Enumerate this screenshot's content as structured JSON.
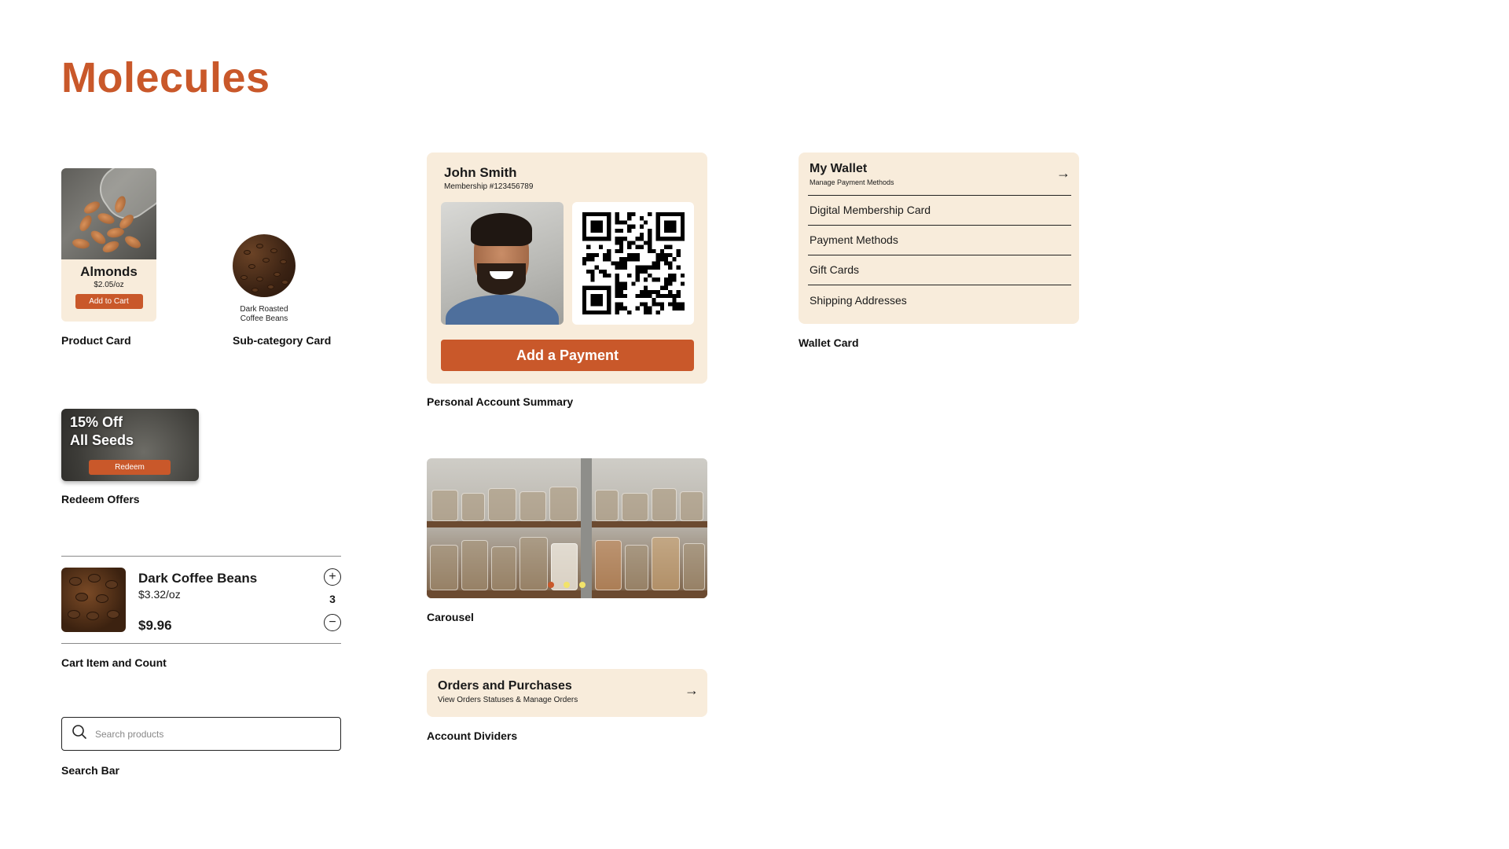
{
  "page": {
    "title": "Molecules"
  },
  "product_card": {
    "name": "Almonds",
    "price": "$2.05/oz",
    "button_label": "Add to Cart",
    "caption": "Product Card"
  },
  "subcategory_card": {
    "label_line1": "Dark Roasted",
    "label_line2": "Coffee Beans",
    "caption": "Sub-category Card"
  },
  "redeem": {
    "line1": "15% Off",
    "line2": "All Seeds",
    "button_label": "Redeem",
    "caption": "Redeem Offers"
  },
  "cart_item": {
    "name": "Dark Coffee Beans",
    "unit_price": "$3.32/oz",
    "total": "$9.96",
    "count": "3",
    "plus_symbol": "+",
    "minus_symbol": "−",
    "caption": "Cart Item and Count"
  },
  "search": {
    "placeholder": "Search products",
    "caption": "Search Bar",
    "icon": "search-icon"
  },
  "account_summary": {
    "name": "John Smith",
    "membership": "Membership #123456789",
    "button_label": "Add a Payment",
    "caption": "Personal Account Summary"
  },
  "carousel": {
    "caption": "Carousel",
    "active_index": 0,
    "dot_count": 3,
    "colors": {
      "active": "#c9582a",
      "inactive": "#f2e36a"
    }
  },
  "account_divider": {
    "title": "Orders and Purchases",
    "subtitle": "View Orders Statuses & Manage Orders",
    "arrow": "→",
    "caption": "Account Dividers"
  },
  "wallet": {
    "title": "My Wallet",
    "subtitle": "Manage Payment Methods",
    "arrow": "→",
    "items": [
      {
        "label": "Digital Membership Card"
      },
      {
        "label": "Payment Methods"
      },
      {
        "label": "Gift Cards"
      },
      {
        "label": "Shipping Addresses"
      }
    ],
    "caption": "Wallet Card"
  },
  "colors": {
    "accent": "#c9582a",
    "cream": "#f8ecdb"
  }
}
